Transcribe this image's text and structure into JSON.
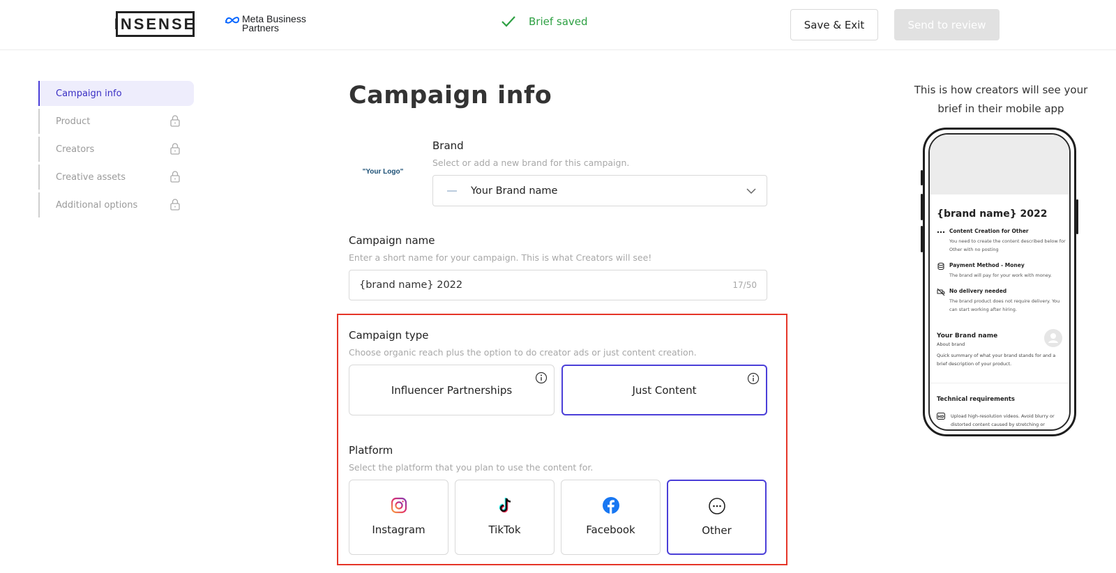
{
  "header": {
    "logo_text": "INSENSE",
    "partner_line1": "Meta Business",
    "partner_line2": "Partners",
    "status_text": "Brief saved",
    "save_exit_label": "Save & Exit",
    "send_review_label": "Send to review",
    "status_color": "#2ea043"
  },
  "sidebar": {
    "items": [
      {
        "label": "Campaign info",
        "active": true,
        "locked": false
      },
      {
        "label": "Product",
        "active": false,
        "locked": true
      },
      {
        "label": "Creators",
        "active": false,
        "locked": true
      },
      {
        "label": "Creative assets",
        "active": false,
        "locked": true
      },
      {
        "label": "Additional options",
        "active": false,
        "locked": true
      }
    ]
  },
  "main": {
    "title": "Campaign info",
    "logo_placeholder": "\"Your Logo\"",
    "brand": {
      "label": "Brand",
      "hint": "Select or add a new brand for this campaign.",
      "value": "Your Brand name"
    },
    "campaign_name": {
      "label": "Campaign name",
      "hint": "Enter a short name for your campaign. This is what Creators will see!",
      "value": "{brand name} 2022",
      "counter": "17/50"
    },
    "campaign_type": {
      "label": "Campaign type",
      "hint": "Choose organic reach plus the option to do creator ads or just content creation.",
      "options": [
        {
          "label": "Influencer Partnerships",
          "selected": false,
          "icon": "info-icon"
        },
        {
          "label": "Just Content",
          "selected": true,
          "icon": "info-icon"
        }
      ]
    },
    "platform": {
      "label": "Platform",
      "hint": "Select the platform that you plan to use the content for.",
      "options": [
        {
          "label": "Instagram",
          "icon": "instagram-icon",
          "selected": false
        },
        {
          "label": "TikTok",
          "icon": "tiktok-icon",
          "selected": false
        },
        {
          "label": "Facebook",
          "icon": "facebook-icon",
          "selected": false
        },
        {
          "label": "Other",
          "icon": "more-icon",
          "selected": true
        }
      ]
    },
    "accent_color": "#4b3fd8",
    "highlight_color": "#e53528"
  },
  "preview": {
    "caption": "This is how creators will see your brief in their mobile app",
    "title": "{brand name} 2022",
    "rows": [
      {
        "title": "Content Creation for Other",
        "desc": "You need to create the content described below for Other with no posting",
        "icon": "dots-icon"
      },
      {
        "title": "Payment Method - Money",
        "desc": "The brand will pay for your work with money.",
        "icon": "coins-icon"
      },
      {
        "title": "No delivery needed",
        "desc": "The brand product does not require delivery. You can start working after hiring.",
        "icon": "no-delivery-icon"
      }
    ],
    "brand_name": "Your Brand name",
    "about": "About brand",
    "summary": "Quick summary of what your brand stands for and a brief description of your product.",
    "tech_title": "Technical requirements",
    "tech_text": "Upload high-resolution videos. Avoid blurry or distorted content caused by stretching or"
  }
}
